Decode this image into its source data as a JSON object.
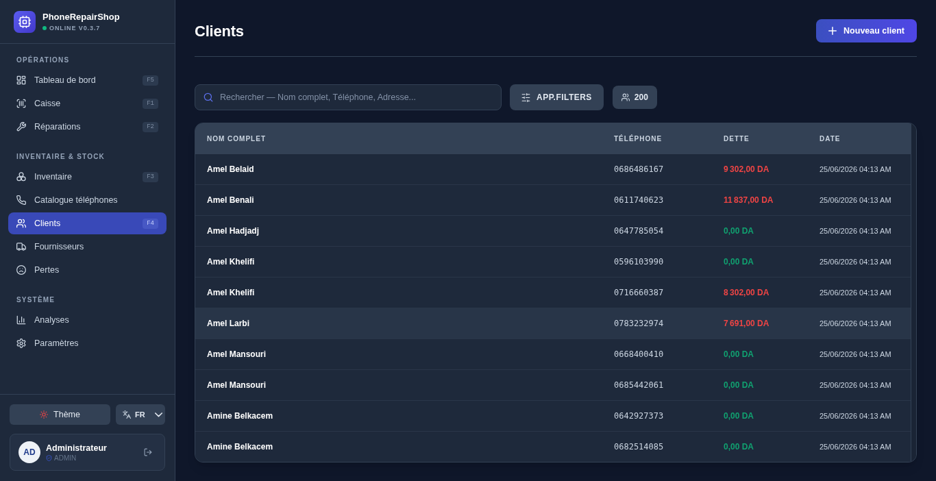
{
  "sidebar": {
    "app_name": "PhoneRepairShop",
    "status": {
      "label": "ONLINE V0.3.7",
      "online": true
    },
    "sections": [
      {
        "title": "OPÉRATIONS",
        "items": [
          {
            "label": "Tableau de bord",
            "shortcut": "F5",
            "selected": false
          },
          {
            "label": "Caisse",
            "shortcut": "F1",
            "selected": false
          },
          {
            "label": "Réparations",
            "shortcut": "F2",
            "selected": false
          }
        ]
      },
      {
        "title": "INVENTAIRE & STOCK",
        "items": [
          {
            "label": "Inventaire",
            "shortcut": "F3",
            "selected": false
          },
          {
            "label": "Catalogue téléphones",
            "selected": false
          },
          {
            "label": "Clients",
            "shortcut": "F4",
            "selected": true
          },
          {
            "label": "Fournisseurs",
            "selected": false
          },
          {
            "label": "Pertes",
            "selected": false
          }
        ]
      },
      {
        "title": "SYSTÈME",
        "items": [
          {
            "label": "Analyses",
            "selected": false
          },
          {
            "label": "Paramètres",
            "selected": false
          }
        ]
      }
    ],
    "theme_button": "Thème",
    "language": {
      "value": "FR"
    },
    "user": {
      "initials": "AD",
      "name": "Administrateur",
      "role": "ADMIN"
    }
  },
  "header": {
    "title": "Clients",
    "new_button": "Nouveau client"
  },
  "toolbar": {
    "search": {
      "placeholder": "Rechercher — Nom complet, Téléphone, Adresse..."
    },
    "filters_button": "APP.FILTERS",
    "count": "200"
  },
  "table": {
    "columns": [
      "NOM COMPLET",
      "TÉLÉPHONE",
      "DETTE",
      "DATE"
    ],
    "rows": [
      {
        "name": "Amel Belaid",
        "phone": "0686486167",
        "debt": "9 302,00 DA",
        "owed": true,
        "date": "25/06/2026 04:13 AM",
        "hovered": false
      },
      {
        "name": "Amel Benali",
        "phone": "0611740623",
        "debt": "11 837,00 DA",
        "owed": true,
        "date": "25/06/2026 04:13 AM",
        "hovered": false
      },
      {
        "name": "Amel Hadjadj",
        "phone": "0647785054",
        "debt": "0,00 DA",
        "owed": false,
        "date": "25/06/2026 04:13 AM",
        "hovered": false
      },
      {
        "name": "Amel Khelifi",
        "phone": "0596103990",
        "debt": "0,00 DA",
        "owed": false,
        "date": "25/06/2026 04:13 AM",
        "hovered": false
      },
      {
        "name": "Amel Khelifi",
        "phone": "0716660387",
        "debt": "8 302,00 DA",
        "owed": true,
        "date": "25/06/2026 04:13 AM",
        "hovered": false
      },
      {
        "name": "Amel Larbi",
        "phone": "0783232974",
        "debt": "7 691,00 DA",
        "owed": true,
        "date": "25/06/2026 04:13 AM",
        "hovered": true
      },
      {
        "name": "Amel Mansouri",
        "phone": "0668400410",
        "debt": "0,00 DA",
        "owed": false,
        "date": "25/06/2026 04:13 AM",
        "hovered": false
      },
      {
        "name": "Amel Mansouri",
        "phone": "0685442061",
        "debt": "0,00 DA",
        "owed": false,
        "date": "25/06/2026 04:13 AM",
        "hovered": false
      },
      {
        "name": "Amine Belkacem",
        "phone": "0642927373",
        "debt": "0,00 DA",
        "owed": false,
        "date": "25/06/2026 04:13 AM",
        "hovered": false
      },
      {
        "name": "Amine Belkacem",
        "phone": "0682514085",
        "debt": "0,00 DA",
        "owed": false,
        "date": "25/06/2026 04:13 AM",
        "hovered": false
      }
    ]
  }
}
